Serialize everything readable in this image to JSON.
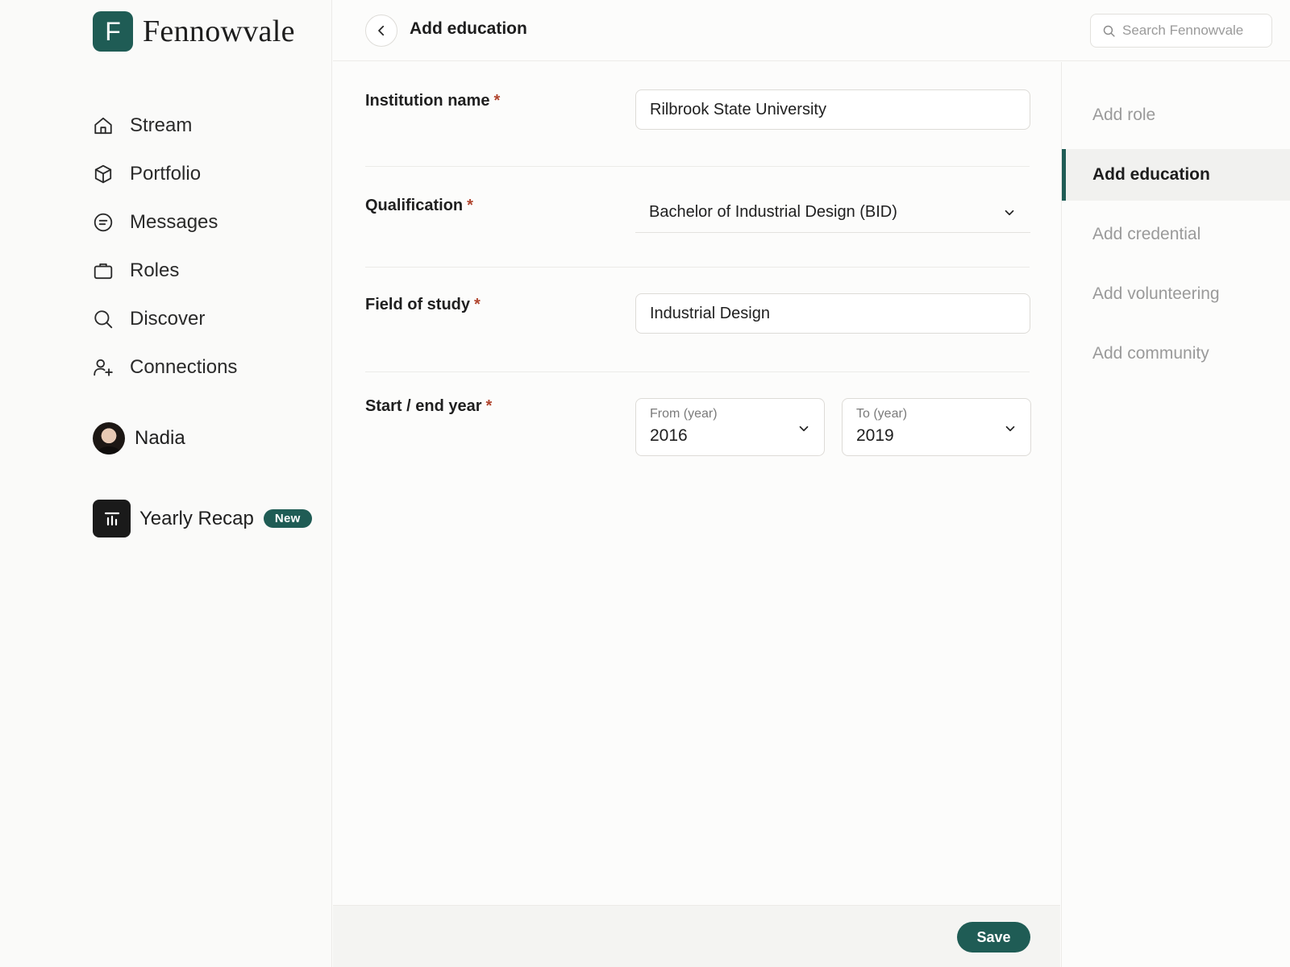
{
  "brand": {
    "logo_letter": "F",
    "name": "Fennowvale"
  },
  "nav": {
    "items": [
      {
        "label": "Stream",
        "icon": "home-icon"
      },
      {
        "label": "Portfolio",
        "icon": "cube-icon"
      },
      {
        "label": "Messages",
        "icon": "message-icon"
      },
      {
        "label": "Roles",
        "icon": "briefcase-icon"
      },
      {
        "label": "Discover",
        "icon": "search-icon"
      },
      {
        "label": "Connections",
        "icon": "user-plus-icon"
      }
    ]
  },
  "profile": {
    "name": "Nadia"
  },
  "recap": {
    "label": "Yearly Recap",
    "badge": "New"
  },
  "header": {
    "title": "Add education"
  },
  "search": {
    "placeholder": "Search Fennowvale",
    "value": ""
  },
  "form": {
    "required_mark": "*",
    "institution": {
      "label": "Institution name",
      "value": "Rilbrook State University"
    },
    "qualification": {
      "label": "Qualification",
      "value": "Bachelor of Industrial Design (BID)"
    },
    "field_of_study": {
      "label": "Field of study",
      "value": "Industrial Design"
    },
    "years": {
      "label": "Start / end year",
      "from": {
        "caption": "From (year)",
        "value": "2016"
      },
      "to": {
        "caption": "To (year)",
        "value": "2019"
      }
    }
  },
  "footer": {
    "save_label": "Save"
  },
  "rightnav": {
    "items": [
      {
        "label": "Add role",
        "active": false
      },
      {
        "label": "Add education",
        "active": true
      },
      {
        "label": "Add credential",
        "active": false
      },
      {
        "label": "Add volunteering",
        "active": false
      },
      {
        "label": "Add community",
        "active": false
      }
    ]
  },
  "colors": {
    "accent": "#1f5c55",
    "required": "#b0452e"
  }
}
